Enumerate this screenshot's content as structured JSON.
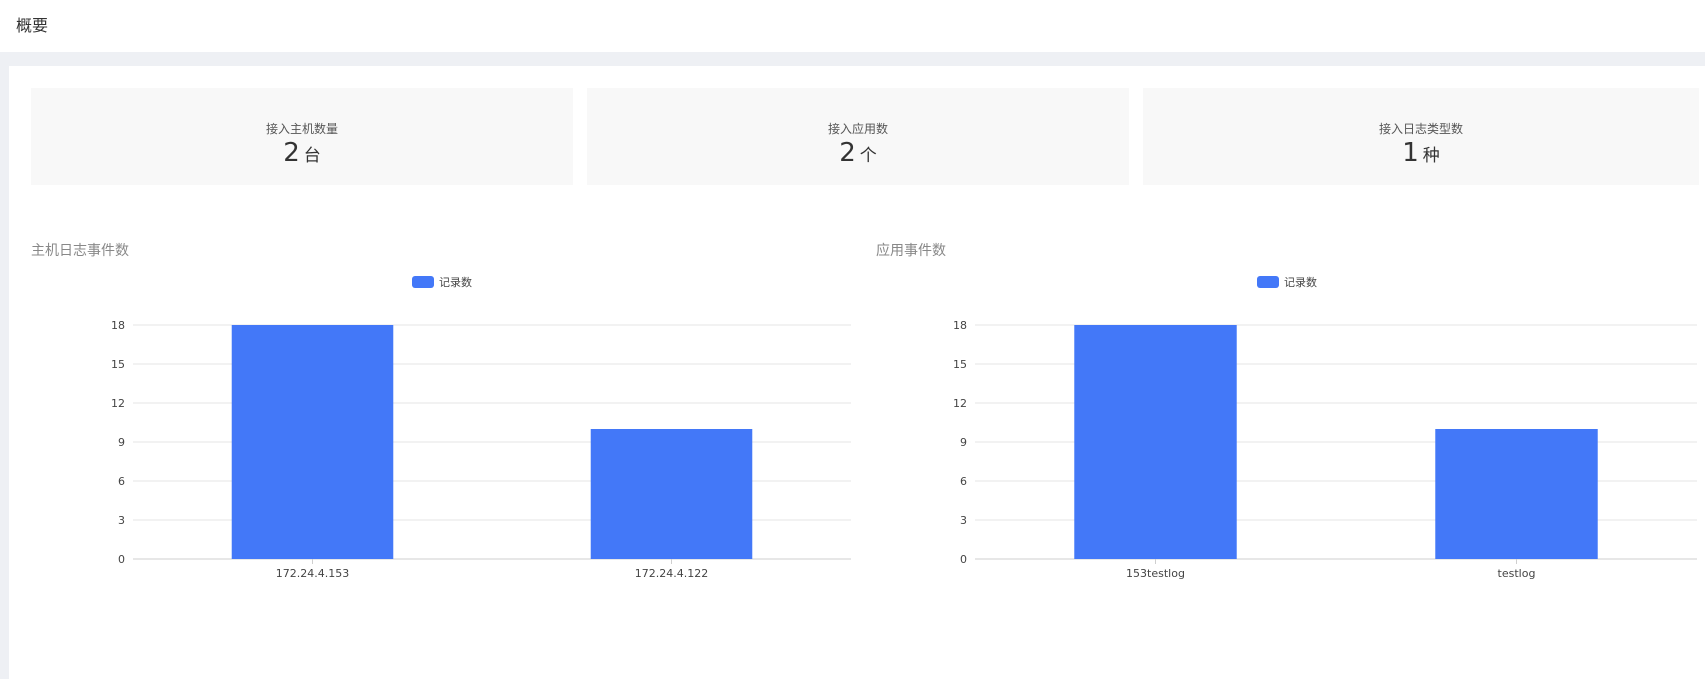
{
  "page_title": "概要",
  "stats": [
    {
      "label": "接入主机数量",
      "value": "2",
      "unit": "台"
    },
    {
      "label": "接入应用数",
      "value": "2",
      "unit": "个"
    },
    {
      "label": "接入日志类型数",
      "value": "1",
      "unit": "种"
    }
  ],
  "colors": {
    "bar": "#4378f8",
    "grid": "#e4e4e4",
    "axis": "#cfcfcf"
  },
  "charts": [
    {
      "title": "主机日志事件数"
    },
    {
      "title": "应用事件数"
    }
  ],
  "chart_data": [
    {
      "type": "bar",
      "categories": [
        "172.24.4.153",
        "172.24.4.122"
      ],
      "series": [
        {
          "name": "记录数",
          "values": [
            18,
            10
          ]
        }
      ],
      "ylim": [
        0,
        18
      ],
      "yticks": [
        0,
        3,
        6,
        9,
        12,
        15,
        18
      ],
      "grid": true,
      "legend": "top-center"
    },
    {
      "type": "bar",
      "categories": [
        "153testlog",
        "testlog"
      ],
      "series": [
        {
          "name": "记录数",
          "values": [
            18,
            10
          ]
        }
      ],
      "ylim": [
        0,
        18
      ],
      "yticks": [
        0,
        3,
        6,
        9,
        12,
        15,
        18
      ],
      "grid": true,
      "legend": "top-center"
    }
  ]
}
